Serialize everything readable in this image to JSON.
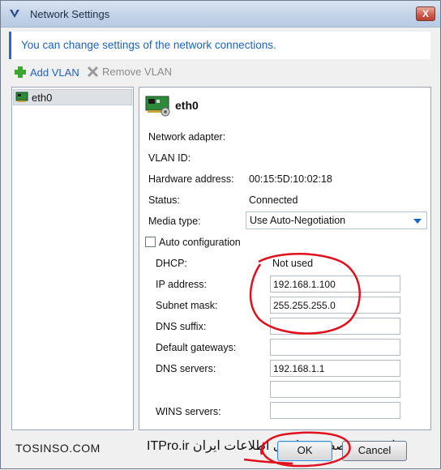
{
  "window": {
    "title": "Network Settings",
    "close_symbol": "X"
  },
  "info": {
    "text": "You can change settings of the network connections."
  },
  "toolbar": {
    "add_vlan": "Add VLAN",
    "remove_vlan": "Remove VLAN"
  },
  "adapters": [
    {
      "label": "eth0"
    }
  ],
  "details": {
    "name": "eth0",
    "network_adapter_label": "Network adapter:",
    "vlan_id_label": "VLAN ID:",
    "hardware_address_label": "Hardware address:",
    "hardware_address": "00:15:5D:10:02:18",
    "status_label": "Status:",
    "status": "Connected",
    "media_type_label": "Media type:",
    "media_type": "Use Auto-Negotiation",
    "auto_config_label": "Auto configuration",
    "dhcp_label": "DHCP:",
    "dhcp": "Not used",
    "ip_label": "IP address:",
    "ip": "192.168.1.100",
    "subnet_label": "Subnet mask:",
    "subnet": "255.255.255.0",
    "dns_suffix_label": "DNS suffix:",
    "gateways_label": "Default gateways:",
    "dns_servers_label": "DNS servers:",
    "dns_server_1": "192.168.1.1",
    "wins_label": "WINS servers:"
  },
  "buttons": {
    "ok": "OK",
    "cancel": "Cancel"
  },
  "watermark": {
    "left": "TOSINSO.COM",
    "right": "انجمن تخصصی فناوری اطلاعات ایران ITPro.ir"
  },
  "colors": {
    "accent": "#1b63c6",
    "annotation": "#e0101e"
  },
  "icons": {
    "app": "network-settings-icon",
    "add": "green-plus-icon",
    "remove": "gray-x-icon",
    "adapter": "network-card-icon"
  }
}
